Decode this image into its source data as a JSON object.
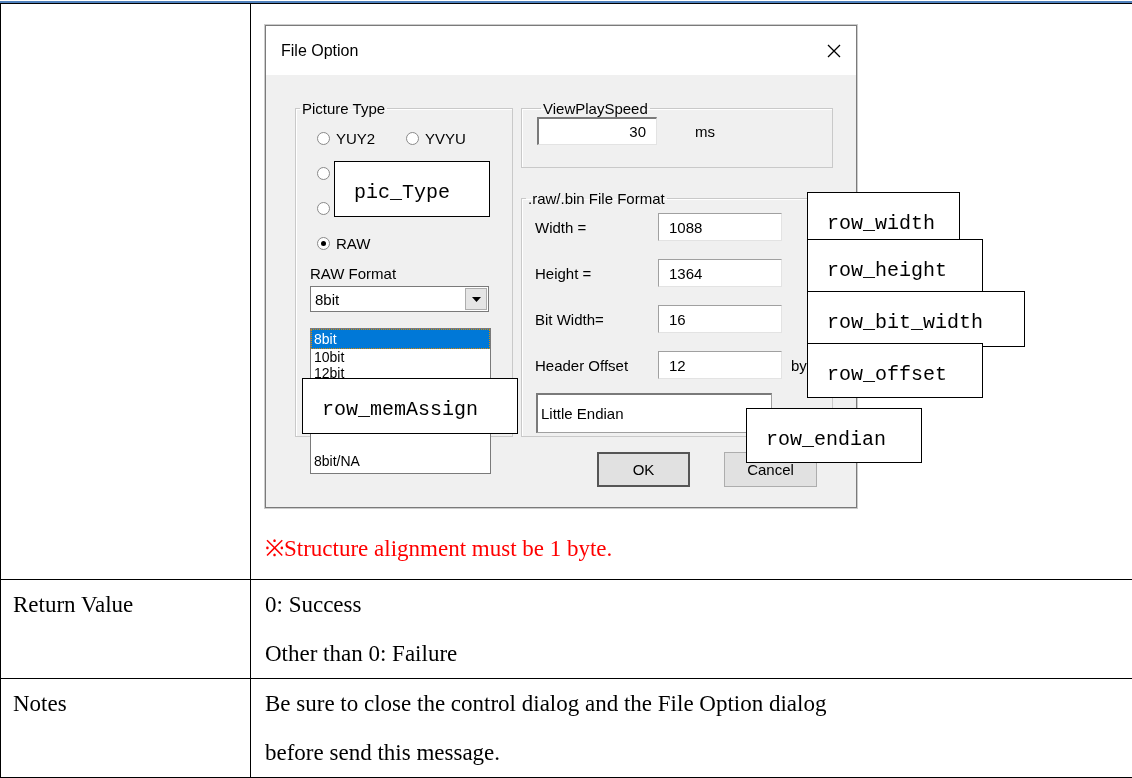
{
  "dialog": {
    "title": "File Option",
    "picture_type": {
      "title": "Picture Type",
      "options": [
        {
          "label": "YUY2",
          "selected": false
        },
        {
          "label": "YVYU",
          "selected": false
        },
        {
          "selected": false
        },
        {
          "selected": false
        },
        {
          "label": "RAW",
          "selected": true
        }
      ]
    },
    "raw_format": {
      "label": "RAW Format",
      "value": "8bit",
      "options": [
        {
          "label": "8bit",
          "selected": true
        },
        {
          "label": "10bit",
          "selected": false
        },
        {
          "label": "12bit",
          "selected": false
        },
        {
          "label": "8bit/NA",
          "selected": false
        }
      ]
    },
    "view_play_speed": {
      "title": "ViewPlaySpeed",
      "value": "30",
      "unit": "ms"
    },
    "file_format": {
      "title": ".raw/.bin File Format",
      "fields": [
        {
          "label": "Width =",
          "value": "1088"
        },
        {
          "label": "Height =",
          "value": "1364"
        },
        {
          "label": "Bit Width=",
          "value": "16"
        },
        {
          "label": "Header Offset",
          "value": "12",
          "unit": "by"
        }
      ],
      "endian": "Little Endian"
    },
    "buttons": [
      {
        "label": "OK",
        "default": true
      },
      {
        "label": "Cancel",
        "default": false
      }
    ]
  },
  "callouts": [
    {
      "text": "pic_Type"
    },
    {
      "text": "row_width"
    },
    {
      "text": "row_height"
    },
    {
      "text": "row_bit_width"
    },
    {
      "text": "row_offset"
    },
    {
      "text": "row_memAssign"
    },
    {
      "text": "row_endian"
    }
  ],
  "note": "※Structure alignment must be 1 byte.",
  "rows": [
    {
      "label": "Return Value",
      "lines": [
        "0: Success",
        "Other than 0: Failure"
      ]
    },
    {
      "label": "Notes",
      "lines": [
        "Be sure to close the control dialog and the File Option dialog",
        "before send this message."
      ]
    }
  ]
}
